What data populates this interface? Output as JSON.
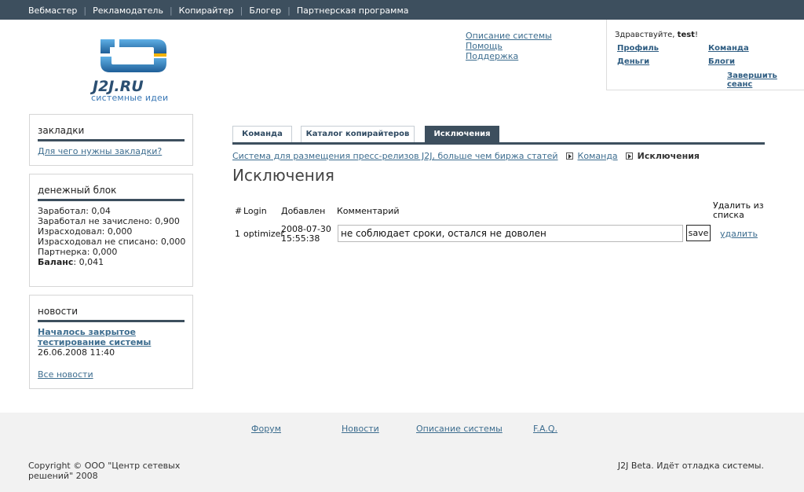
{
  "topnav": {
    "items": [
      "Вебмастер",
      "Рекламодатель",
      "Копирайтер",
      "Блогер",
      "Партнерская программа"
    ]
  },
  "logo": {
    "text": "J2J.RU",
    "subtitle": "системные идеи"
  },
  "header_links": [
    "Описание системы",
    "Помощь",
    "Поддержка"
  ],
  "userbox": {
    "greeting": "Здравствуйте,",
    "username": "test",
    "greeting_end": "!",
    "profile": "Профиль",
    "team": "Команда",
    "money": "Деньги",
    "blogs": "Блоги",
    "logout": "Завершить сеанс"
  },
  "sidebar": {
    "bookmarks": {
      "title": "закладки",
      "link": "Для чего нужны закладки?"
    },
    "money": {
      "title": "денежный блок",
      "lines": [
        "Заработал: 0,04",
        "Заработал не зачислено: 0,900",
        "Израсходовал: 0,000",
        "Израсходовал не списано: 0,000",
        "Партнерка: 0,000"
      ],
      "balance_label": "Баланс",
      "balance_value": ": 0,041"
    },
    "news": {
      "title": "новости",
      "headline": "Началось закрытое тестирование системы",
      "date": "26.06.2008 11:40",
      "all_link": "Все новости"
    }
  },
  "main": {
    "tabs": [
      "Команда",
      "Каталог копирайтеров",
      "Исключения"
    ],
    "active_tab": "Исключения",
    "breadcrumb": {
      "root": "Система для размещения пресс-релизов J2J, больше чем биржа статей",
      "team": "Команда",
      "current": "Исключения"
    },
    "title": "Исключения",
    "table": {
      "headers": {
        "num": "#",
        "login": "Login",
        "added": "Добавлен",
        "comment": "Комментарий",
        "delete": "Удалить из списка"
      },
      "rows": [
        {
          "num": "1",
          "login": "optimizer",
          "date": "2008-07-30",
          "time": "15:55:38",
          "comment": "не соблюдает сроки, остался не доволен",
          "save": "save",
          "delete": "удалить"
        }
      ]
    }
  },
  "footer": {
    "links": [
      "Форум",
      "Новости",
      "Описание системы",
      "F.A.Q."
    ],
    "copyright": "Copyright © ООО \"Центр сетевых решений\" 2008",
    "status": "J2J Beta. Идёт отладка системы."
  },
  "colors": {
    "nav_bg": "#3d4f5e",
    "link": "#3d6d8f",
    "logo_blue": "#2b7fc0"
  }
}
